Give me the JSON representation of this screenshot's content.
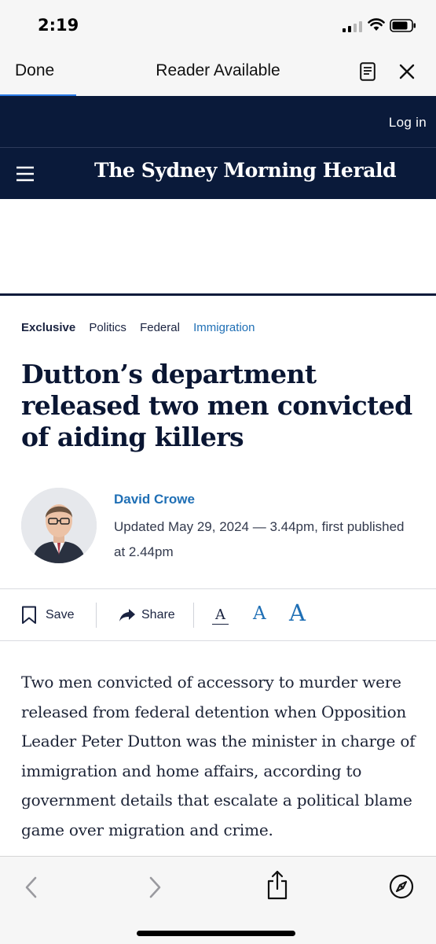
{
  "status_bar": {
    "time": "2:19"
  },
  "safari_bar": {
    "done_label": "Done",
    "reader_label": "Reader Available"
  },
  "site": {
    "login_label": "Log in",
    "masthead": "The Sydney Morning Herald",
    "brand_color": "#0a1a3a",
    "link_color": "#1f6fb5"
  },
  "article": {
    "breadcrumbs": [
      "Exclusive",
      "Politics",
      "Federal",
      "Immigration"
    ],
    "headline": "Dutton’s department released two men convicted of aiding killers",
    "author": "David Crowe",
    "updated": "Updated May 29, 2024 — 3.44pm, first published at 2.44pm",
    "body": "Two men convicted of accessory to murder were released from federal detention when Opposition Leader Peter Dutton was the minister in charge of immigration and home affairs, according to government details that escalate a political blame game over migration and crime."
  },
  "tools": {
    "save_label": "Save",
    "share_label": "Share",
    "font_small": "A",
    "font_medium": "A",
    "font_large": "A"
  },
  "icons": {
    "signal": "signal-icon",
    "wifi": "wifi-icon",
    "battery": "battery-icon",
    "reader": "reader-icon",
    "close": "close-icon",
    "menu": "menu-icon",
    "save": "bookmark-icon",
    "share": "share-arrow-icon",
    "back": "chevron-left-icon",
    "forward": "chevron-right-icon",
    "share_sheet": "share-sheet-icon",
    "compass": "compass-icon"
  }
}
